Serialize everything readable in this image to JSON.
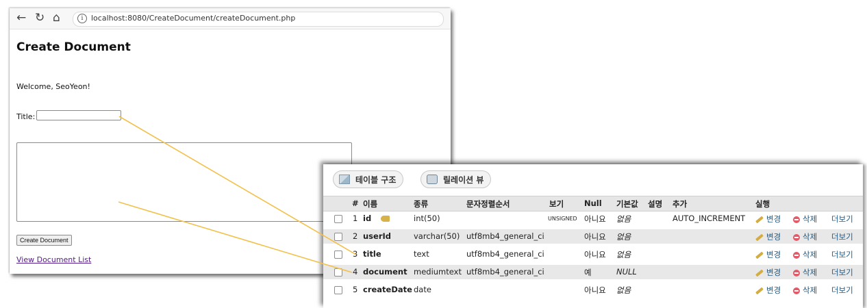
{
  "browser": {
    "url": "localhost:8080/CreateDocument/createDocument.php",
    "page_title": "Create Document",
    "welcome": "Welcome, SeoYeon!",
    "title_label": "Title:",
    "create_button": "Create Document",
    "view_link": "View Document List"
  },
  "icons": {
    "back": "back-arrow-icon",
    "refresh": "refresh-icon",
    "home": "home-icon",
    "info": "info-icon",
    "table": "table-structure-icon",
    "relation": "relation-view-icon",
    "key": "primary-key-icon",
    "edit": "pencil-icon",
    "delete": "delete-icon"
  },
  "pma": {
    "tabs": [
      "테이블 구조",
      "릴레이션 뷰"
    ],
    "headers": [
      "#",
      "이름",
      "종류",
      "문자정렬순서",
      "보기",
      "Null",
      "기본값",
      "설명",
      "추가",
      "실행"
    ],
    "rows": [
      {
        "num": "1",
        "name": "id",
        "type": "int(50)",
        "collation": "",
        "attributes": "UNSIGNED",
        "null": "아니요",
        "default": "없음",
        "extra": "AUTO_INCREMENT"
      },
      {
        "num": "2",
        "name": "userId",
        "type": "varchar(50)",
        "collation": "utf8mb4_general_ci",
        "attributes": "",
        "null": "아니요",
        "default": "없음",
        "extra": ""
      },
      {
        "num": "3",
        "name": "title",
        "type": "text",
        "collation": "utf8mb4_general_ci",
        "attributes": "",
        "null": "아니요",
        "default": "없음",
        "extra": ""
      },
      {
        "num": "4",
        "name": "document",
        "type": "mediumtext",
        "collation": "utf8mb4_general_ci",
        "attributes": "",
        "null": "예",
        "default": "NULL",
        "extra": ""
      },
      {
        "num": "5",
        "name": "createDate",
        "type": "date",
        "collation": "",
        "attributes": "",
        "null": "아니요",
        "default": "없음",
        "extra": ""
      }
    ],
    "actions": {
      "edit": "변경",
      "delete": "삭제",
      "more": "더보기"
    }
  },
  "colors": {
    "connector": "#f2c14b",
    "link": "#235a81",
    "visited_link": "#551a8b"
  }
}
